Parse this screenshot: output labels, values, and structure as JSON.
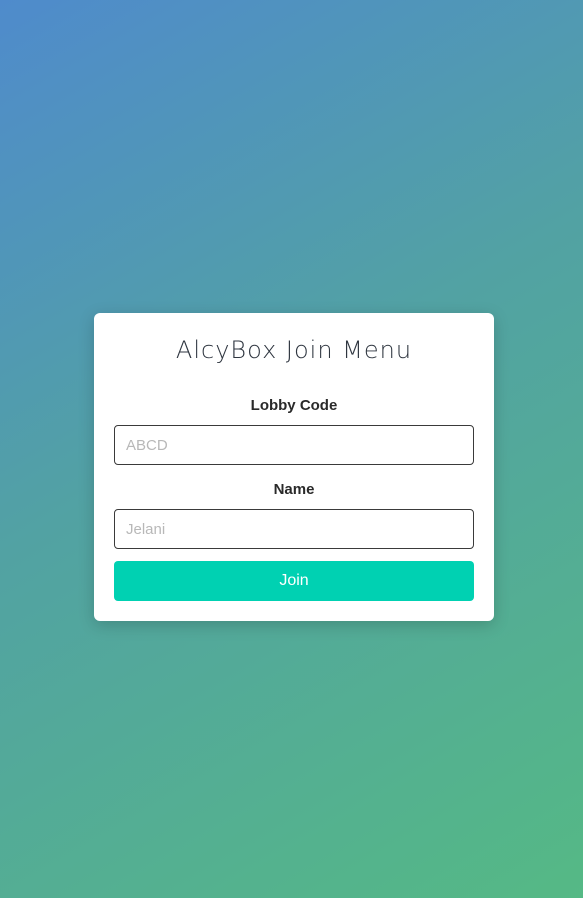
{
  "menu": {
    "title": "AlcyBox Join Menu",
    "lobby_code": {
      "label": "Lobby Code",
      "value": "",
      "placeholder": "ABCD"
    },
    "name": {
      "label": "Name",
      "value": "",
      "placeholder": "Jelani"
    },
    "join_label": "Join"
  },
  "colors": {
    "background_gradient_start": "#4f8bcc",
    "background_gradient_end": "#55b985",
    "button": "#00d1b2",
    "card": "#ffffff"
  }
}
